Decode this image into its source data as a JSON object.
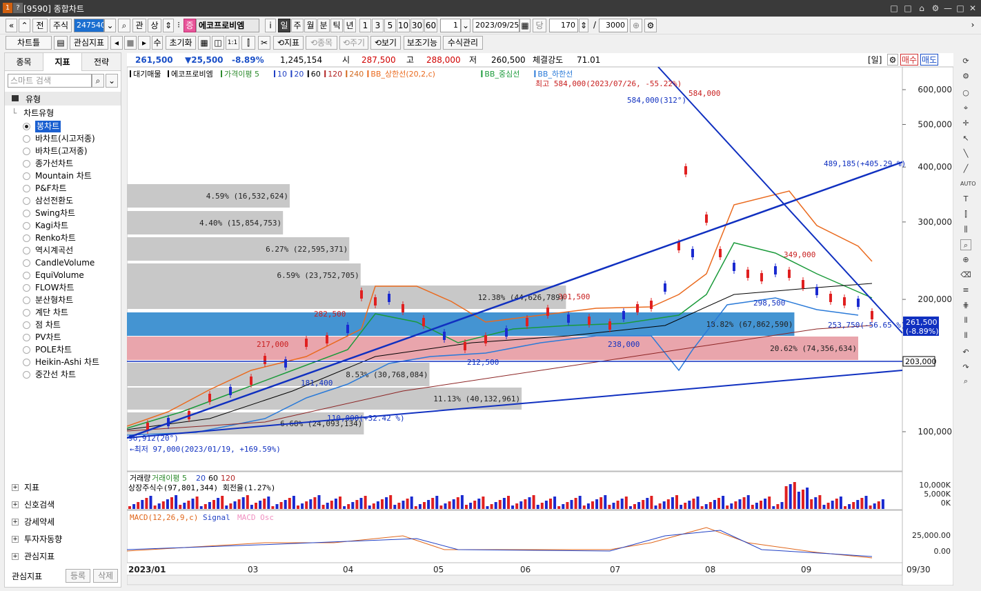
{
  "window": {
    "badge1": "1",
    "badge2": "?",
    "title": "[9590] 종합차트",
    "controls": [
      "□",
      "□",
      "⌂",
      "⚙",
      "—",
      "□",
      "✕"
    ]
  },
  "toolbar1": {
    "nav_first": "«",
    "nav_prev": "»",
    "prev_label": "전",
    "type_label": "주식",
    "code_value": "247540",
    "search_icon": "⌕",
    "rel_label": "관",
    "up_label": "상",
    "stock_badge": "증",
    "stock_name": "에코프로비엠",
    "info_btn": "i",
    "periods": [
      "일",
      "주",
      "월",
      "분",
      "틱",
      "년"
    ],
    "period_active": "일",
    "minutes": [
      "1",
      "3",
      "5",
      "10",
      "30",
      "60"
    ],
    "interval_value": "1",
    "date_value": "2023/09/25",
    "count_label": "당",
    "count_value": "170",
    "slash": "/",
    "total_value": "3000"
  },
  "toolbar2": {
    "chart_label": "차트틀",
    "interest_label": "관심지표",
    "sum_label": "수",
    "reset_label": "초기화",
    "one_to_one": "1:1",
    "indicator_label": "지표",
    "item_label": "종목",
    "period_label": "주기",
    "view_label": "보기",
    "aux_label": "보조기능",
    "formula_label": "수식관리"
  },
  "sidebar": {
    "tabs": [
      "종목",
      "지표",
      "전략"
    ],
    "active_tab": "지표",
    "search_placeholder": "스마트 검색",
    "type_header": "유형",
    "group_label": "차트유형",
    "items": [
      "봉차트",
      "바차트(시고저종)",
      "바차트(고저종)",
      "종가선차트",
      "Mountain 차트",
      "P&F차트",
      "삼선전환도",
      "Swing차트",
      "Kagi차트",
      "Renko차트",
      "역시계곡선",
      "CandleVolume",
      "EquiVolume",
      "FLOW차트",
      "분산형차트",
      "계단 차트",
      "점 차트",
      "PV차트",
      "POLE차트",
      "Heikin-Ashi 차트",
      "중간선 차트"
    ],
    "selected_item": "봉차트",
    "groups": [
      "지표",
      "신호검색",
      "강세약세",
      "투자자동향",
      "관심지표"
    ],
    "footer_label": "관심지표",
    "register_btn": "등록",
    "delete_btn": "삭제"
  },
  "infobar": {
    "price": "261,500",
    "change": "▼25,500",
    "rate": "-8.89%",
    "volume": "1,245,154",
    "open_label": "시",
    "open": "287,500",
    "high_label": "고",
    "high": "288,000",
    "low_label": "저",
    "low": "260,500",
    "strength_label": "체결강도",
    "strength": "71.01",
    "period_tag": "[일]",
    "buy_btn": "매수",
    "sell_btn": "매도"
  },
  "legend": {
    "items": [
      "대기매물",
      "에코프로비엠",
      "가격이평 5",
      "10",
      "20",
      "60",
      "120",
      "240",
      "BB_상한선(20,2,c)",
      "BB_중심선",
      "BB_하한선"
    ],
    "colors": [
      "#000000",
      "#000000",
      "#2e8b2e",
      "#1f3fc4",
      "#1f3fc4",
      "#000000",
      "#b22222",
      "#d2691e",
      "#ea6a1e",
      "#1a9a3a",
      "#2a7ad8"
    ]
  },
  "price_axis": {
    "labels": [
      "600,000",
      "500,000",
      "400,000",
      "300,000",
      "200,000",
      "100,000"
    ],
    "values": [
      600000,
      500000,
      400000,
      300000,
      200000,
      100000
    ],
    "current": "261,500",
    "current_rate": "(-8.89%)",
    "mark": "203,000"
  },
  "annotations": {
    "max_text": "최고 584,000(2023/07/26, -55.22%)",
    "max_arrow": "→",
    "max_price": "584,000",
    "max_angle": "584,000(312°)",
    "line_label": "489,185(+405.29 %)",
    "a349": "349,000",
    "a298": "298,500",
    "a253": "253,750(-56.65 %)",
    "a253b": "253,750",
    "a238": "238,000",
    "a212": "212,500",
    "a181": "181,400",
    "a217": "217,000",
    "a282": "282,500",
    "a301": "301,500",
    "a97": "96,912(20°)",
    "a110": "110,000(+32.42 %)",
    "min_text": "←최저 97,000(2023/01/19, +169.59%)"
  },
  "volume_profile": [
    {
      "label": "4.59% (16,532,624)",
      "pct": 4.59
    },
    {
      "label": "4.40% (15,854,753)",
      "pct": 4.4
    },
    {
      "label": "6.27% (22,595,371)",
      "pct": 6.27
    },
    {
      "label": "6.59% (23,752,705)",
      "pct": 6.59
    },
    {
      "label": "12.38% (44,626,789)",
      "pct": 12.38
    },
    {
      "label": "18.82% (67,862,590)",
      "pct": 18.82
    },
    {
      "label": "20.62% (74,356,634)",
      "pct": 20.62
    },
    {
      "label": "8.53% (30,768,084)",
      "pct": 8.53
    },
    {
      "label": "11.13% (40,132,961)",
      "pct": 11.13
    },
    {
      "label": "6.68% (24,093,134)",
      "pct": 6.68
    }
  ],
  "volume_panel": {
    "legend": [
      "거래량",
      "거래이평 5",
      "20",
      "60",
      "120"
    ],
    "sub": "상장주식수(97,801,344) 회전율(1.27%)",
    "labels": [
      "10,000K",
      "5,000K",
      "0K"
    ]
  },
  "macd_panel": {
    "legend": [
      "MACD(12,26,9,c)",
      "Signal",
      "MACD Osc"
    ],
    "labels": [
      "25,000.00",
      "0.00"
    ]
  },
  "time_axis": {
    "labels": [
      "2023/01",
      "03",
      "04",
      "05",
      "06",
      "07",
      "08",
      "09",
      "09/30"
    ]
  }
}
